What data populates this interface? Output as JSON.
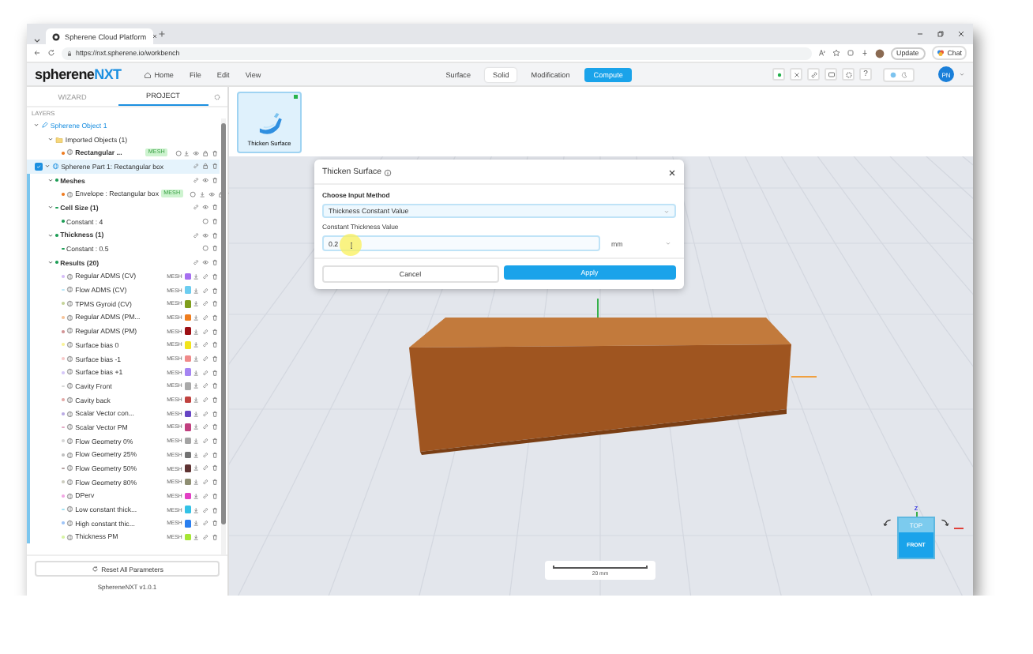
{
  "browser": {
    "tab_title": "Spherene Cloud Platform",
    "url": "https://nxt.spherene.io/workbench",
    "update_label": "Update",
    "chat_label": "Chat"
  },
  "header": {
    "logo": {
      "text": "spherene",
      "accent": "NXT"
    },
    "menu": [
      "Home",
      "File",
      "Edit",
      "View"
    ],
    "mode_tabs": [
      {
        "label": "Surface",
        "kind": "tab",
        "selected": false
      },
      {
        "label": "Solid",
        "kind": "tab",
        "selected": true
      },
      {
        "label": "Modification",
        "kind": "tab",
        "selected": false
      }
    ],
    "compute_label": "Compute",
    "help_label": "?",
    "dark_mode": false,
    "avatar_initials": "PN"
  },
  "sidebar": {
    "tabs": [
      {
        "label": "WIZARD",
        "selected": false
      },
      {
        "label": "PROJECT",
        "selected": true
      }
    ],
    "section_label": "LAYERS",
    "tree": [
      {
        "label": "Spherene Object 1",
        "kind": "object",
        "expanded": true,
        "selected": false,
        "children": [
          {
            "label": "Imported Objects (1)",
            "kind": "folder",
            "expanded": true,
            "selected": false,
            "children": [
              {
                "label": "Rectangular ...",
                "kind": "mesh",
                "badge": "MESH",
                "selected": false
              }
            ]
          },
          {
            "label": "Spherene Part 1: Rectangular box",
            "kind": "part",
            "expanded": true,
            "selected": true,
            "children": [
              {
                "label": "Meshes",
                "kind": "group",
                "expanded": true,
                "selected": false,
                "children": [
                  {
                    "label": "Envelope : Rectangular box",
                    "kind": "mesh",
                    "badge": "MESH",
                    "selected": false
                  }
                ]
              },
              {
                "label": "Cell Size (1)",
                "kind": "group",
                "expanded": true,
                "selected": false,
                "children": [
                  {
                    "label": "Constant : 4",
                    "kind": "param",
                    "selected": false
                  }
                ]
              },
              {
                "label": "Thickness (1)",
                "kind": "group",
                "expanded": true,
                "selected": false,
                "children": [
                  {
                    "label": "Constant : 0.5",
                    "kind": "param",
                    "selected": false
                  }
                ]
              },
              {
                "label": "Results (20)",
                "kind": "group",
                "expanded": true,
                "selected": false,
                "children": [
                  {
                    "label": "Regular ADMS (CV)",
                    "kind": "result",
                    "tag": "MESH",
                    "color": "#a66ff0",
                    "selected": false
                  },
                  {
                    "label": "Flow ADMS (CV)",
                    "kind": "result",
                    "tag": "MESH",
                    "color": "#6ccdf0",
                    "selected": false
                  },
                  {
                    "label": "TPMS Gyroid (CV)",
                    "kind": "result",
                    "tag": "MESH",
                    "color": "#7f9e1c",
                    "selected": false
                  },
                  {
                    "label": "Regular ADMS (PM...",
                    "kind": "result",
                    "tag": "MESH",
                    "color": "#ee7d1e",
                    "selected": false
                  },
                  {
                    "label": "Regular ADMS (PM)",
                    "kind": "result",
                    "tag": "MESH",
                    "color": "#9c0f14",
                    "selected": false
                  },
                  {
                    "label": "Surface bias 0",
                    "kind": "result",
                    "tag": "MESH",
                    "color": "#f2e41c",
                    "selected": false
                  },
                  {
                    "label": "Surface bias -1",
                    "kind": "result",
                    "tag": "MESH",
                    "color": "#f08a8a",
                    "selected": false
                  },
                  {
                    "label": "Surface bias +1",
                    "kind": "result",
                    "tag": "MESH",
                    "color": "#a585f2",
                    "selected": false
                  },
                  {
                    "label": "Cavity Front",
                    "kind": "result",
                    "tag": "MESH",
                    "color": "#a9a9a9",
                    "selected": false
                  },
                  {
                    "label": "Cavity back",
                    "kind": "result",
                    "tag": "MESH",
                    "color": "#c0423f",
                    "selected": false
                  },
                  {
                    "label": "Scalar Vector con...",
                    "kind": "result",
                    "tag": "MESH",
                    "color": "#6645c4",
                    "selected": false
                  },
                  {
                    "label": "Scalar Vector PM",
                    "kind": "result",
                    "tag": "MESH",
                    "color": "#c0407f",
                    "selected": false
                  },
                  {
                    "label": "Flow Geometry 0%",
                    "kind": "result",
                    "tag": "MESH",
                    "color": "#a3a3a3",
                    "selected": false
                  },
                  {
                    "label": "Flow Geometry 25%",
                    "kind": "result",
                    "tag": "MESH",
                    "color": "#737373",
                    "selected": false
                  },
                  {
                    "label": "Flow Geometry 50%",
                    "kind": "result",
                    "tag": "MESH",
                    "color": "#5e3232",
                    "selected": false
                  },
                  {
                    "label": "Flow Geometry 80%",
                    "kind": "result",
                    "tag": "MESH",
                    "color": "#8e8e72",
                    "selected": false
                  },
                  {
                    "label": "DPerv",
                    "kind": "result",
                    "tag": "MESH",
                    "color": "#e23fc4",
                    "selected": false
                  },
                  {
                    "label": "Low constant thick...",
                    "kind": "result",
                    "tag": "MESH",
                    "color": "#33c2e6",
                    "selected": false
                  },
                  {
                    "label": "High constant thic...",
                    "kind": "result",
                    "tag": "MESH",
                    "color": "#2a7ff0",
                    "selected": false
                  },
                  {
                    "label": "Thickness PM",
                    "kind": "result",
                    "tag": "MESH",
                    "color": "#a6e635",
                    "selected": false
                  }
                ]
              }
            ]
          }
        ]
      }
    ],
    "reset_label": "Reset All Parameters",
    "version": "SphereneNXT v1.0.1"
  },
  "toolbar": {
    "tools": [
      {
        "label": "Thicken Surface",
        "selected": true
      }
    ]
  },
  "dialog": {
    "title": "Thicken Surface",
    "method_label": "Choose Input Method",
    "method_value": "Thickness Constant Value",
    "value_label": "Constant Thickness Value",
    "value": "0.2",
    "unit": "mm",
    "buttons": [
      {
        "label": "Cancel",
        "kind": "secondary"
      },
      {
        "label": "Apply",
        "kind": "primary"
      }
    ]
  },
  "viewport": {
    "scale_label": "20 mm",
    "view_cube": {
      "axis_label": "Z",
      "top": "TOP",
      "front": "FRONT"
    }
  }
}
